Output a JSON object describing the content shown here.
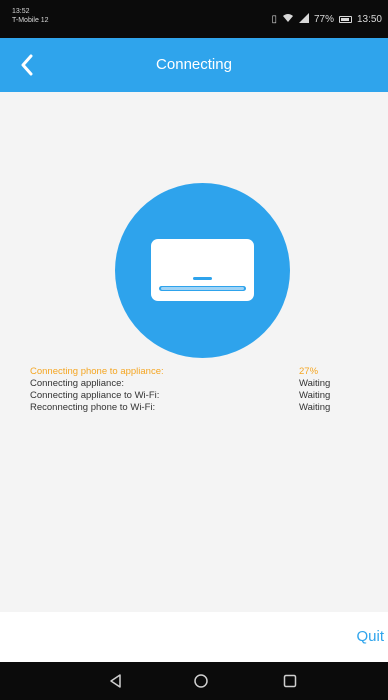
{
  "status_bar": {
    "time_small": "13:52",
    "carrier": "T-Mobile 12",
    "battery_percent": "77%",
    "clock": "13:50",
    "icons": [
      "vibrate-icon",
      "wifi-icon",
      "signal-icon",
      "battery-icon"
    ]
  },
  "header": {
    "title": "Connecting",
    "back_icon": "back-arrow-icon"
  },
  "main": {
    "appliance_icon": "air-conditioner-icon",
    "steps": [
      {
        "label": "Connecting phone to appliance:",
        "status": "27%",
        "active": true
      },
      {
        "label": "Connecting appliance:",
        "status": "Waiting",
        "active": false
      },
      {
        "label": "Connecting appliance to Wi-Fi:",
        "status": "Waiting",
        "active": false
      },
      {
        "label": "Reconnecting phone to Wi-Fi:",
        "status": "Waiting",
        "active": false
      }
    ]
  },
  "footer": {
    "quit_label": "Quit"
  },
  "colors": {
    "accent": "#2fa4ec",
    "active_step": "#f5a623",
    "background": "#f4f4f4"
  },
  "nav_bar": {
    "icons": [
      "nav-back-icon",
      "nav-home-icon",
      "nav-recent-icon"
    ]
  }
}
